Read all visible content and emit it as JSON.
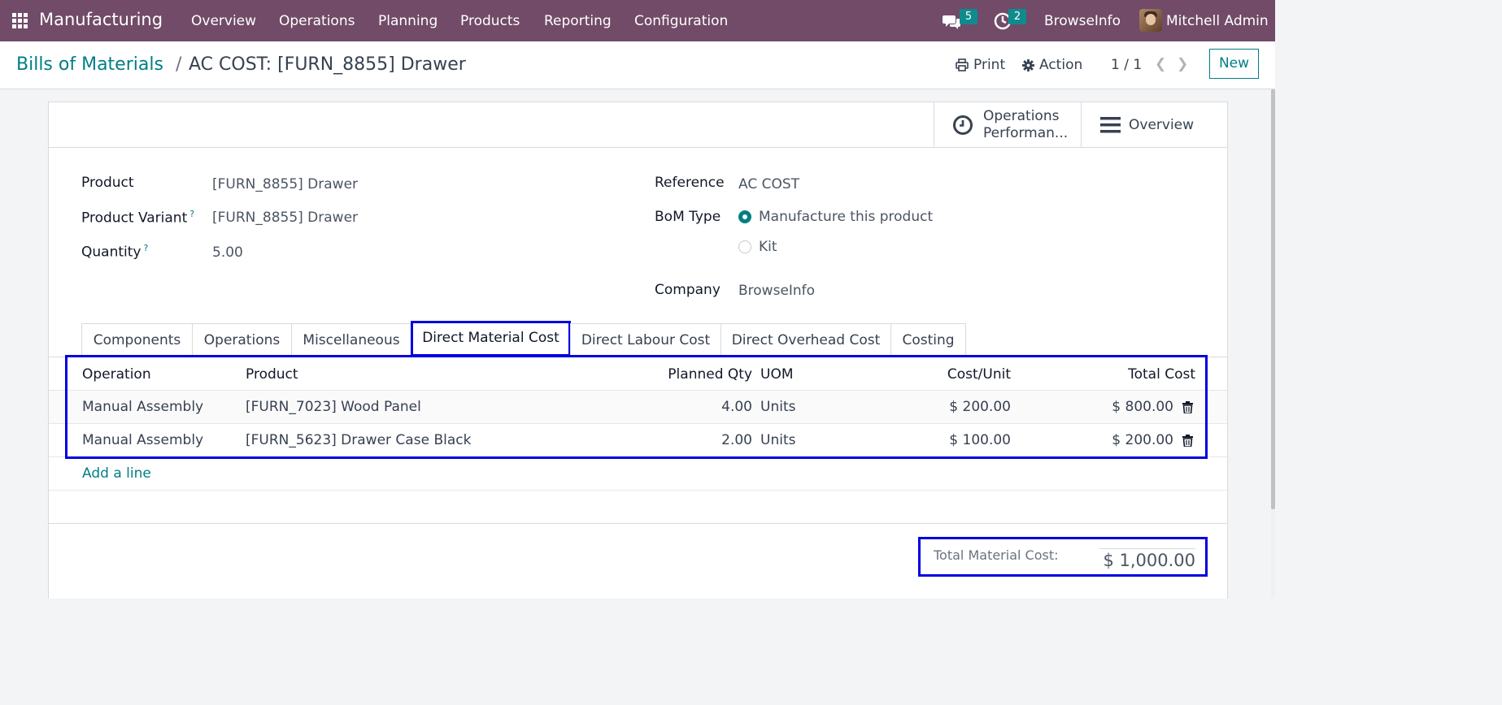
{
  "navbar": {
    "app_name": "Manufacturing",
    "menu": [
      "Overview",
      "Operations",
      "Planning",
      "Products",
      "Reporting",
      "Configuration"
    ],
    "messages_badge": "5",
    "activities_badge": "2",
    "company": "BrowseInfo",
    "user": "Mitchell Admin",
    "bg_color": "#714b67"
  },
  "control_panel": {
    "breadcrumb_parent": "Bills of Materials",
    "breadcrumb_sep": "/",
    "breadcrumb_current": "AC COST: [FURN_8855] Drawer",
    "print_label": "Print",
    "action_label": "Action",
    "pager": "1 / 1",
    "new_label": "New"
  },
  "smart_buttons": {
    "operations_performance_line1": "Operations",
    "operations_performance_line2": "Performan...",
    "overview": "Overview"
  },
  "form": {
    "product_label": "Product",
    "product_value": "[FURN_8855] Drawer",
    "variant_label": "Product Variant",
    "variant_value": "[FURN_8855] Drawer",
    "quantity_label": "Quantity",
    "quantity_value": "5.00",
    "help_mark": "?",
    "reference_label": "Reference",
    "reference_value": "AC COST",
    "bom_type_label": "BoM Type",
    "bom_type_options": [
      "Manufacture this product",
      "Kit"
    ],
    "bom_type_selected": "Manufacture this product",
    "company_label": "Company",
    "company_value": "BrowseInfo"
  },
  "tabs": [
    "Components",
    "Operations",
    "Miscellaneous",
    "Direct Material Cost",
    "Direct Labour Cost",
    "Direct Overhead Cost",
    "Costing"
  ],
  "active_tab": "Direct Material Cost",
  "material_table": {
    "headers": [
      "Operation",
      "Product",
      "Planned Qty",
      "UOM",
      "Cost/Unit",
      "Total Cost"
    ],
    "rows": [
      {
        "operation": "Manual Assembly",
        "product": "[FURN_7023] Wood Panel",
        "planned_qty": "4.00",
        "uom": "Units",
        "cost_unit": "$ 200.00",
        "total_cost": "$ 800.00"
      },
      {
        "operation": "Manual Assembly",
        "product": "[FURN_5623] Drawer Case Black",
        "planned_qty": "2.00",
        "uom": "Units",
        "cost_unit": "$ 100.00",
        "total_cost": "$ 200.00"
      }
    ],
    "add_line": "Add a line"
  },
  "totals": {
    "label": "Total Material Cost:",
    "value": "$ 1,000.00"
  },
  "colors": {
    "accent": "#017e84",
    "highlight": "#0000e0",
    "badge": "#0f8b8d"
  }
}
